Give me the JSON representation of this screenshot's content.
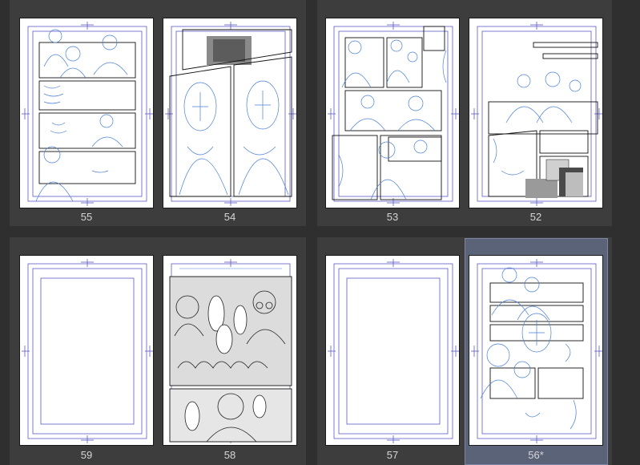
{
  "pages": [
    {
      "id": "p55",
      "number": "55"
    },
    {
      "id": "p54",
      "number": "54"
    },
    {
      "id": "p53",
      "number": "53"
    },
    {
      "id": "p52",
      "number": "52"
    },
    {
      "id": "p59",
      "number": "59"
    },
    {
      "id": "p58",
      "number": "58"
    },
    {
      "id": "p57",
      "number": "57"
    },
    {
      "id": "p56",
      "number": "56*",
      "selected": true
    }
  ],
  "colors": {
    "background": "#2f2f2f",
    "spread": "#3d3d3d",
    "selection": "#5a6378",
    "guide": "#5b5bc4",
    "sketch": "#4a7fd6"
  }
}
